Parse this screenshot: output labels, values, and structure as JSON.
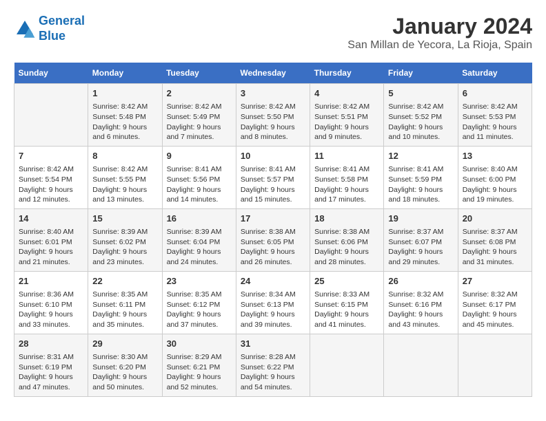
{
  "header": {
    "logo_line1": "General",
    "logo_line2": "Blue",
    "month_title": "January 2024",
    "subtitle": "San Millan de Yecora, La Rioja, Spain"
  },
  "weekdays": [
    "Sunday",
    "Monday",
    "Tuesday",
    "Wednesday",
    "Thursday",
    "Friday",
    "Saturday"
  ],
  "weeks": [
    [
      {
        "day": "",
        "info": ""
      },
      {
        "day": "1",
        "info": "Sunrise: 8:42 AM\nSunset: 5:48 PM\nDaylight: 9 hours\nand 6 minutes."
      },
      {
        "day": "2",
        "info": "Sunrise: 8:42 AM\nSunset: 5:49 PM\nDaylight: 9 hours\nand 7 minutes."
      },
      {
        "day": "3",
        "info": "Sunrise: 8:42 AM\nSunset: 5:50 PM\nDaylight: 9 hours\nand 8 minutes."
      },
      {
        "day": "4",
        "info": "Sunrise: 8:42 AM\nSunset: 5:51 PM\nDaylight: 9 hours\nand 9 minutes."
      },
      {
        "day": "5",
        "info": "Sunrise: 8:42 AM\nSunset: 5:52 PM\nDaylight: 9 hours\nand 10 minutes."
      },
      {
        "day": "6",
        "info": "Sunrise: 8:42 AM\nSunset: 5:53 PM\nDaylight: 9 hours\nand 11 minutes."
      }
    ],
    [
      {
        "day": "7",
        "info": "Sunrise: 8:42 AM\nSunset: 5:54 PM\nDaylight: 9 hours\nand 12 minutes."
      },
      {
        "day": "8",
        "info": "Sunrise: 8:42 AM\nSunset: 5:55 PM\nDaylight: 9 hours\nand 13 minutes."
      },
      {
        "day": "9",
        "info": "Sunrise: 8:41 AM\nSunset: 5:56 PM\nDaylight: 9 hours\nand 14 minutes."
      },
      {
        "day": "10",
        "info": "Sunrise: 8:41 AM\nSunset: 5:57 PM\nDaylight: 9 hours\nand 15 minutes."
      },
      {
        "day": "11",
        "info": "Sunrise: 8:41 AM\nSunset: 5:58 PM\nDaylight: 9 hours\nand 17 minutes."
      },
      {
        "day": "12",
        "info": "Sunrise: 8:41 AM\nSunset: 5:59 PM\nDaylight: 9 hours\nand 18 minutes."
      },
      {
        "day": "13",
        "info": "Sunrise: 8:40 AM\nSunset: 6:00 PM\nDaylight: 9 hours\nand 19 minutes."
      }
    ],
    [
      {
        "day": "14",
        "info": "Sunrise: 8:40 AM\nSunset: 6:01 PM\nDaylight: 9 hours\nand 21 minutes."
      },
      {
        "day": "15",
        "info": "Sunrise: 8:39 AM\nSunset: 6:02 PM\nDaylight: 9 hours\nand 23 minutes."
      },
      {
        "day": "16",
        "info": "Sunrise: 8:39 AM\nSunset: 6:04 PM\nDaylight: 9 hours\nand 24 minutes."
      },
      {
        "day": "17",
        "info": "Sunrise: 8:38 AM\nSunset: 6:05 PM\nDaylight: 9 hours\nand 26 minutes."
      },
      {
        "day": "18",
        "info": "Sunrise: 8:38 AM\nSunset: 6:06 PM\nDaylight: 9 hours\nand 28 minutes."
      },
      {
        "day": "19",
        "info": "Sunrise: 8:37 AM\nSunset: 6:07 PM\nDaylight: 9 hours\nand 29 minutes."
      },
      {
        "day": "20",
        "info": "Sunrise: 8:37 AM\nSunset: 6:08 PM\nDaylight: 9 hours\nand 31 minutes."
      }
    ],
    [
      {
        "day": "21",
        "info": "Sunrise: 8:36 AM\nSunset: 6:10 PM\nDaylight: 9 hours\nand 33 minutes."
      },
      {
        "day": "22",
        "info": "Sunrise: 8:35 AM\nSunset: 6:11 PM\nDaylight: 9 hours\nand 35 minutes."
      },
      {
        "day": "23",
        "info": "Sunrise: 8:35 AM\nSunset: 6:12 PM\nDaylight: 9 hours\nand 37 minutes."
      },
      {
        "day": "24",
        "info": "Sunrise: 8:34 AM\nSunset: 6:13 PM\nDaylight: 9 hours\nand 39 minutes."
      },
      {
        "day": "25",
        "info": "Sunrise: 8:33 AM\nSunset: 6:15 PM\nDaylight: 9 hours\nand 41 minutes."
      },
      {
        "day": "26",
        "info": "Sunrise: 8:32 AM\nSunset: 6:16 PM\nDaylight: 9 hours\nand 43 minutes."
      },
      {
        "day": "27",
        "info": "Sunrise: 8:32 AM\nSunset: 6:17 PM\nDaylight: 9 hours\nand 45 minutes."
      }
    ],
    [
      {
        "day": "28",
        "info": "Sunrise: 8:31 AM\nSunset: 6:19 PM\nDaylight: 9 hours\nand 47 minutes."
      },
      {
        "day": "29",
        "info": "Sunrise: 8:30 AM\nSunset: 6:20 PM\nDaylight: 9 hours\nand 50 minutes."
      },
      {
        "day": "30",
        "info": "Sunrise: 8:29 AM\nSunset: 6:21 PM\nDaylight: 9 hours\nand 52 minutes."
      },
      {
        "day": "31",
        "info": "Sunrise: 8:28 AM\nSunset: 6:22 PM\nDaylight: 9 hours\nand 54 minutes."
      },
      {
        "day": "",
        "info": ""
      },
      {
        "day": "",
        "info": ""
      },
      {
        "day": "",
        "info": ""
      }
    ]
  ]
}
